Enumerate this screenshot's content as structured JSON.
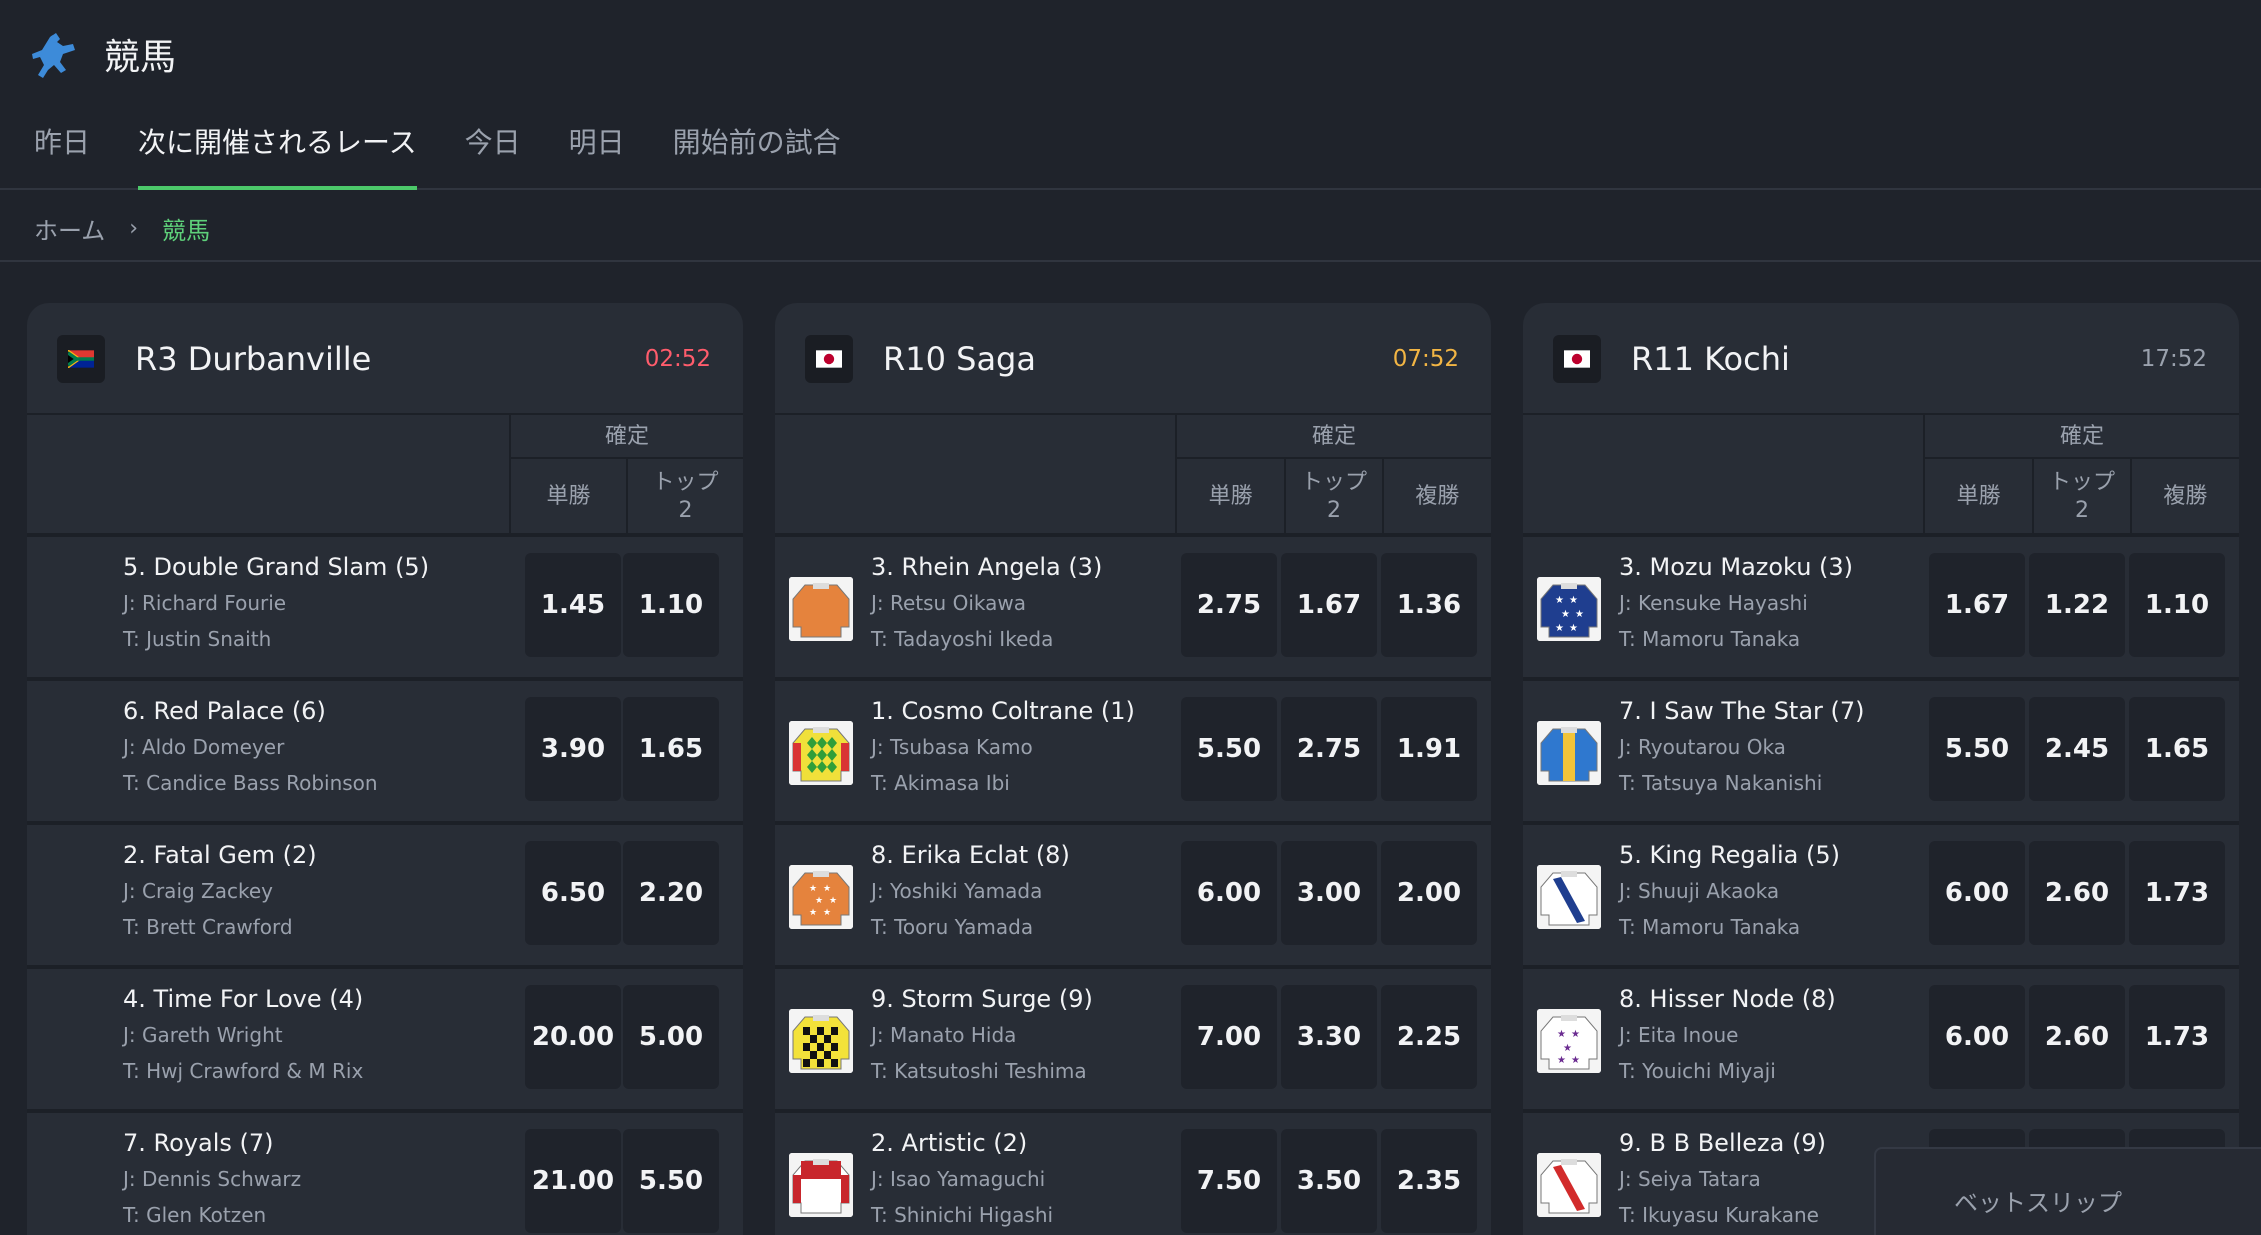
{
  "header": {
    "title": "競馬",
    "icon": "horse-racing-icon",
    "accent_color": "#4cc96a"
  },
  "tabs": [
    {
      "label": "昨日",
      "active": false
    },
    {
      "label": "次に開催されるレース",
      "active": true
    },
    {
      "label": "今日",
      "active": false
    },
    {
      "label": "明日",
      "active": false
    },
    {
      "label": "開始前の試合",
      "active": false
    }
  ],
  "breadcrumb": {
    "home": "ホーム",
    "current": "競馬"
  },
  "cards": [
    {
      "title": "R3 Durbanville",
      "time": "02:52",
      "time_color": "#ff5c6c",
      "flag": "south-africa-flag-icon",
      "market_label": "確定",
      "columns": [
        "単勝",
        "トップ\n2"
      ],
      "rows": [
        {
          "name": "5. Double Grand Slam (5)",
          "jockey": "J: Richard Fourie",
          "trainer": "T: Justin Snaith",
          "silk": "none",
          "odds": [
            "1.45",
            "1.10"
          ]
        },
        {
          "name": "6. Red Palace (6)",
          "jockey": "J: Aldo Domeyer",
          "trainer": "T: Candice Bass Robinson",
          "silk": "none",
          "odds": [
            "3.90",
            "1.65"
          ]
        },
        {
          "name": "2. Fatal Gem (2)",
          "jockey": "J: Craig Zackey",
          "trainer": "T: Brett Crawford",
          "silk": "none",
          "odds": [
            "6.50",
            "2.20"
          ]
        },
        {
          "name": "4. Time For Love (4)",
          "jockey": "J: Gareth Wright",
          "trainer": "T: Hwj Crawford & M Rix",
          "silk": "none",
          "odds": [
            "20.00",
            "5.00"
          ]
        },
        {
          "name": "7. Royals (7)",
          "jockey": "J: Dennis Schwarz",
          "trainer": "T: Glen Kotzen",
          "silk": "none",
          "odds": [
            "21.00",
            "5.50"
          ]
        }
      ]
    },
    {
      "title": "R10 Saga",
      "time": "07:52",
      "time_color": "#f2b544",
      "flag": "japan-flag-icon",
      "market_label": "確定",
      "columns": [
        "単勝",
        "トップ\n2",
        "複勝"
      ],
      "rows": [
        {
          "name": "3. Rhein Angela (3)",
          "jockey": "J: Retsu Oikawa",
          "trainer": "T: Tadayoshi Ikeda",
          "silk": "orange-silk-icon",
          "odds": [
            "2.75",
            "1.67",
            "1.36"
          ]
        },
        {
          "name": "1. Cosmo Coltrane (1)",
          "jockey": "J: Tsubasa Kamo",
          "trainer": "T: Akimasa Ibi",
          "silk": "green-yellow-diamond-silk-icon",
          "odds": [
            "5.50",
            "2.75",
            "1.91"
          ]
        },
        {
          "name": "8. Erika Eclat (8)",
          "jockey": "J: Yoshiki Yamada",
          "trainer": "T: Tooru Yamada",
          "silk": "orange-stars-silk-icon",
          "odds": [
            "6.00",
            "3.00",
            "2.00"
          ]
        },
        {
          "name": "9. Storm Surge (9)",
          "jockey": "J: Manato Hida",
          "trainer": "T: Katsutoshi Teshima",
          "silk": "yellow-black-check-silk-icon",
          "odds": [
            "7.00",
            "3.30",
            "2.25"
          ]
        },
        {
          "name": "2. Artistic (2)",
          "jockey": "J: Isao Yamaguchi",
          "trainer": "T: Shinichi Higashi",
          "silk": "red-white-silk-icon",
          "odds": [
            "7.50",
            "3.50",
            "2.35"
          ]
        }
      ]
    },
    {
      "title": "R11 Kochi",
      "time": "17:52",
      "time_color": "#9aa1ad",
      "flag": "japan-flag-icon",
      "market_label": "確定",
      "columns": [
        "単勝",
        "トップ\n2",
        "複勝"
      ],
      "rows": [
        {
          "name": "3. Mozu Mazoku (3)",
          "jockey": "J: Kensuke Hayashi",
          "trainer": "T: Mamoru Tanaka",
          "silk": "blue-stars-silk-icon",
          "odds": [
            "1.67",
            "1.22",
            "1.10"
          ]
        },
        {
          "name": "7. I Saw The Star (7)",
          "jockey": "J: Ryoutarou Oka",
          "trainer": "T: Tatsuya Nakanishi",
          "silk": "blue-silk-icon",
          "odds": [
            "5.50",
            "2.45",
            "1.65"
          ]
        },
        {
          "name": "5. King Regalia (5)",
          "jockey": "J: Shuuji Akaoka",
          "trainer": "T: Mamoru Tanaka",
          "silk": "white-blue-sash-silk-icon",
          "odds": [
            "6.00",
            "2.60",
            "1.73"
          ]
        },
        {
          "name": "8. Hisser Node (8)",
          "jockey": "J: Eita Inoue",
          "trainer": "T: Youichi Miyaji",
          "silk": "white-purple-stars-silk-icon",
          "odds": [
            "6.00",
            "2.60",
            "1.73"
          ]
        },
        {
          "name": "9. B B Belleza (9)",
          "jockey": "J: Seiya Tatara",
          "trainer": "T: Ikuyasu Kurakane",
          "silk": "white-red-sash-silk-icon",
          "odds": [
            "",
            "",
            ""
          ]
        }
      ]
    }
  ],
  "betslip": {
    "label": "ベットスリップ"
  }
}
